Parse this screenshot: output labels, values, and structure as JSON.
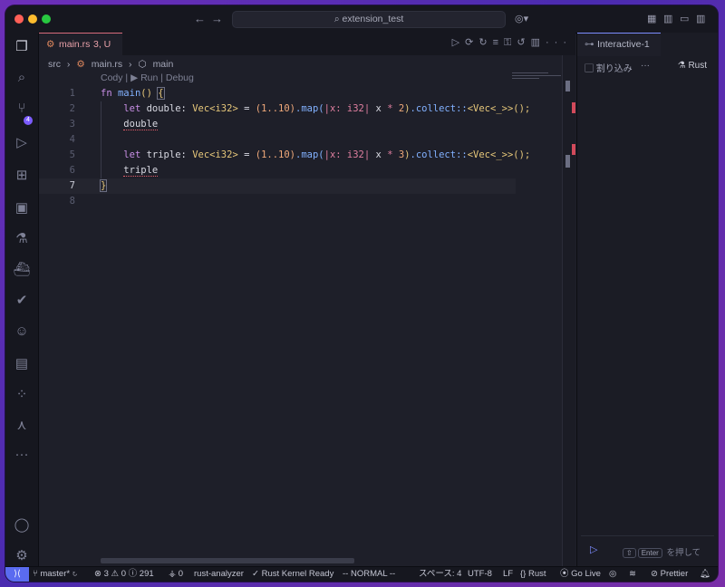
{
  "titlebar": {
    "title": "extension_test",
    "back": "←",
    "forward": "→"
  },
  "activity_bar": {
    "items": [
      "explorer",
      "search",
      "source-control",
      "run-debug",
      "extensions",
      "remote-explorer",
      "testing",
      "docker",
      "checks",
      "copilot",
      "notebook",
      "accounts-grid",
      "source-graph",
      "more"
    ],
    "scm_badge": "4"
  },
  "editor": {
    "tab": {
      "filename": "main.rs",
      "status": "3, U"
    },
    "breadcrumb": {
      "folder": "src",
      "file": "main.rs",
      "symbol": "main"
    },
    "codelens": "Cody | ▶ Run | Debug",
    "current_line": 7,
    "lines": [
      {
        "n": "1"
      },
      {
        "n": "2"
      },
      {
        "n": "3"
      },
      {
        "n": "4"
      },
      {
        "n": "5"
      },
      {
        "n": "6"
      },
      {
        "n": "7"
      },
      {
        "n": "8"
      }
    ],
    "tokens": {
      "fn": "fn",
      "main": "main",
      "paren_open": "()",
      "brace_open": "{",
      "let": "let",
      "double": "double",
      "triple": "triple",
      "colon": ":",
      "vec_type": "Vec<i32>",
      "eq": "=",
      "range1": "(1..10)",
      "map": ".map(",
      "closure_x": "|x: i32|",
      "x": "x",
      "star": "*",
      "two": "2",
      "three": "3",
      "close": ")",
      "collect": ".collect::",
      "vec_gen": "<Vec<_>>();",
      "brace_close": "}"
    }
  },
  "panel": {
    "tab": "Interactive-1",
    "interrupt": "割り込み",
    "more": "···",
    "kernel": "Rust",
    "hint_key1": "⇧",
    "hint_key2": "Enter",
    "hint_text": "を押して"
  },
  "statusbar": {
    "branch": "master*",
    "errors": "3",
    "warnings": "0",
    "info": "291",
    "ports": "0",
    "analyzer": "rust-analyzer",
    "kernel": "Rust Kernel Ready",
    "mode": "-- NORMAL --",
    "spaces": "スペース: 4",
    "encoding": "UTF-8",
    "eol": "LF",
    "language": "Rust",
    "golive": "Go Live",
    "prettier": "Prettier"
  },
  "colors": {
    "accent": "#5a6bf0",
    "error": "#d24a5b",
    "tab_border": "#d76b7c"
  }
}
